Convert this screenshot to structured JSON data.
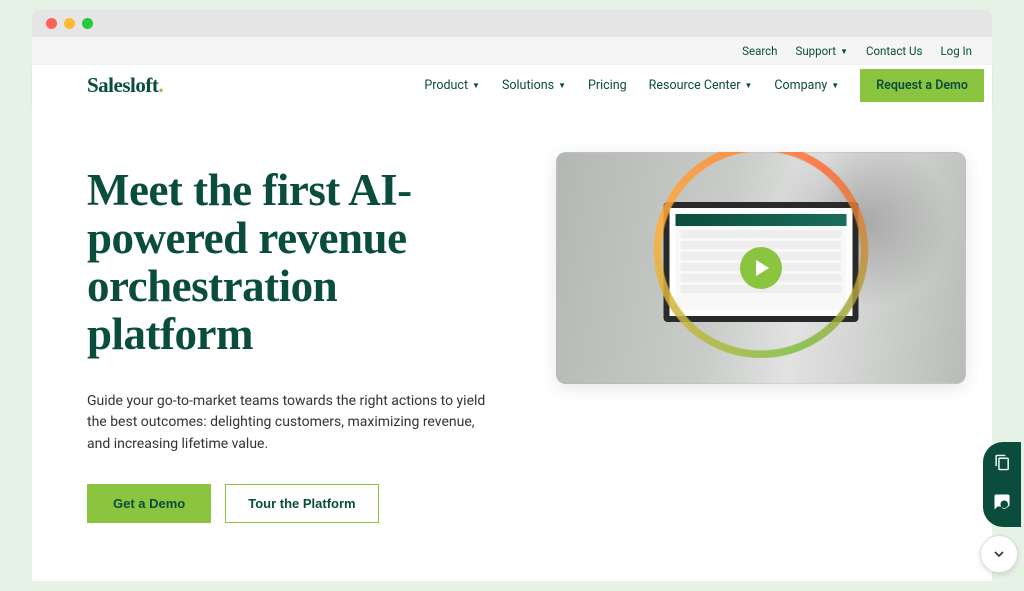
{
  "topbar": {
    "search": "Search",
    "support": "Support",
    "contact": "Contact Us",
    "login": "Log In"
  },
  "logo": {
    "main": "Salesloft",
    "dot": "."
  },
  "nav": {
    "product": "Product",
    "solutions": "Solutions",
    "pricing": "Pricing",
    "resource": "Resource Center",
    "company": "Company",
    "demo": "Request a Demo"
  },
  "hero": {
    "headline": "Meet the first AI-powered revenue orchestration platform",
    "subtext": "Guide your go-to-market teams towards the right actions to yield the best outcomes: delighting customers, maximizing revenue, and increasing lifetime value.",
    "cta_primary": "Get a Demo",
    "cta_secondary": "Tour the Platform"
  }
}
